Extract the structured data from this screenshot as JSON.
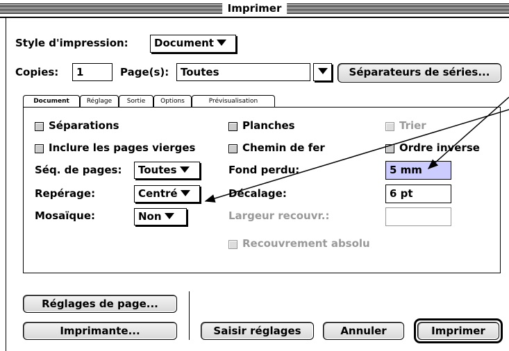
{
  "window": {
    "title": "Imprimer"
  },
  "top": {
    "style_label": "Style d'impression:",
    "style_value": "Document",
    "copies_label": "Copies:",
    "copies_value": "1",
    "pages_label": "Page(s):",
    "pages_value": "Toutes",
    "separators_button": "Séparateurs de séries..."
  },
  "tabs": [
    "Document",
    "Réglage",
    "Sortie",
    "Options",
    "Prévisualisation"
  ],
  "document": {
    "separations": "Séparations",
    "include_blank": "Inclure les pages vierges",
    "page_seq_label": "Séq. de pages:",
    "page_seq_value": "Toutes",
    "registration_label": "Repérage:",
    "registration_value": "Centré",
    "tiling_label": "Mosaïque:",
    "tiling_value": "Non",
    "spreads": "Planches",
    "thumbnails": "Chemin de fer",
    "collate": "Trier",
    "reverse_order": "Ordre inverse",
    "bleed_label": "Fond perdu:",
    "bleed_value": "5 mm",
    "offset_label": "Décalage:",
    "offset_value": "6 pt",
    "overlap_label": "Largeur recouvr.:",
    "overlap_value": "",
    "absolute_overlap": "Recouvrement absolu"
  },
  "buttons": {
    "page_setup": "Réglages de page...",
    "printer": "Imprimante...",
    "capture_settings": "Saisir réglages",
    "cancel": "Annuler",
    "print": "Imprimer"
  },
  "colors": {
    "highlight": "#ccccff",
    "dim": "#999999"
  },
  "icons": {
    "popup": "triangle-down-icon",
    "annotation": "arrow-icon"
  }
}
